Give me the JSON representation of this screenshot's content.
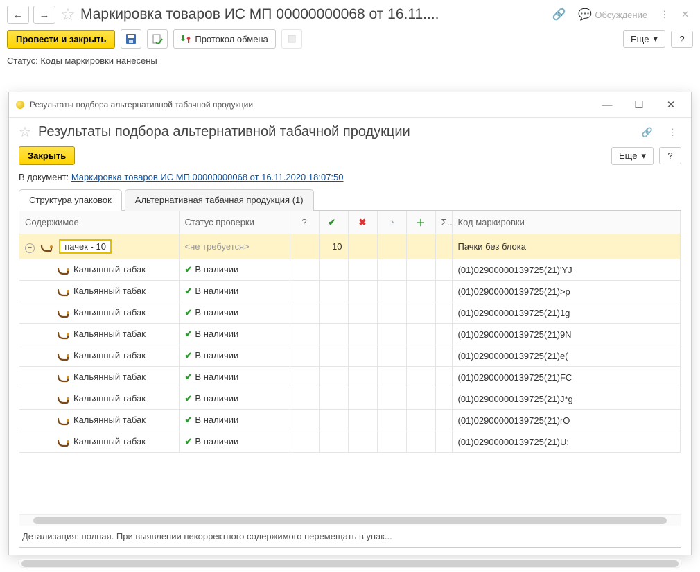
{
  "top": {
    "title": "Маркировка товаров ИС МП 00000000068 от 16.11....",
    "discuss": "Обсуждение"
  },
  "toolbar": {
    "postAndClose": "Провести и закрыть",
    "protocol": "Протокол обмена",
    "more": "Еще",
    "help": "?"
  },
  "status": {
    "label": "Статус:",
    "value": "Коды маркировки нанесены"
  },
  "dialog": {
    "smallTitle": "Результаты подбора альтернативной табачной продукции",
    "title": "Результаты подбора альтернативной табачной продукции",
    "close": "Закрыть",
    "more": "Еще",
    "help": "?",
    "docLabel": "В документ:",
    "docLink": "Маркировка товаров ИС МП 00000000068 от 16.11.2020 18:07:50"
  },
  "tabs": [
    "Структура упаковок",
    "Альтернативная табачная продукция (1)"
  ],
  "activeTab": 0,
  "table": {
    "headers": {
      "content": "Содержимое",
      "status": "Статус проверки",
      "q": "?",
      "sigma": "Σ",
      "code": "Код маркировки"
    },
    "group": {
      "label": "пачек - 10",
      "status": "<не требуется>",
      "count": "10",
      "code": "Пачки без блока"
    },
    "rows": [
      {
        "name": "Кальянный табак",
        "status": "В наличии",
        "code": "(01)02900000139725(21)'YJ"
      },
      {
        "name": "Кальянный табак",
        "status": "В наличии",
        "code": "(01)02900000139725(21)>p"
      },
      {
        "name": "Кальянный табак",
        "status": "В наличии",
        "code": "(01)02900000139725(21)1g"
      },
      {
        "name": "Кальянный табак",
        "status": "В наличии",
        "code": "(01)02900000139725(21)9N"
      },
      {
        "name": "Кальянный табак",
        "status": "В наличии",
        "code": "(01)02900000139725(21)e("
      },
      {
        "name": "Кальянный табак",
        "status": "В наличии",
        "code": "(01)02900000139725(21)FC"
      },
      {
        "name": "Кальянный табак",
        "status": "В наличии",
        "code": "(01)02900000139725(21)J*g"
      },
      {
        "name": "Кальянный табак",
        "status": "В наличии",
        "code": "(01)02900000139725(21)rO"
      },
      {
        "name": "Кальянный табак",
        "status": "В наличии",
        "code": "(01)02900000139725(21)U:"
      }
    ]
  },
  "detail": "Детализация: полная. При выявлении некорректного содержимого перемещать в упак..."
}
